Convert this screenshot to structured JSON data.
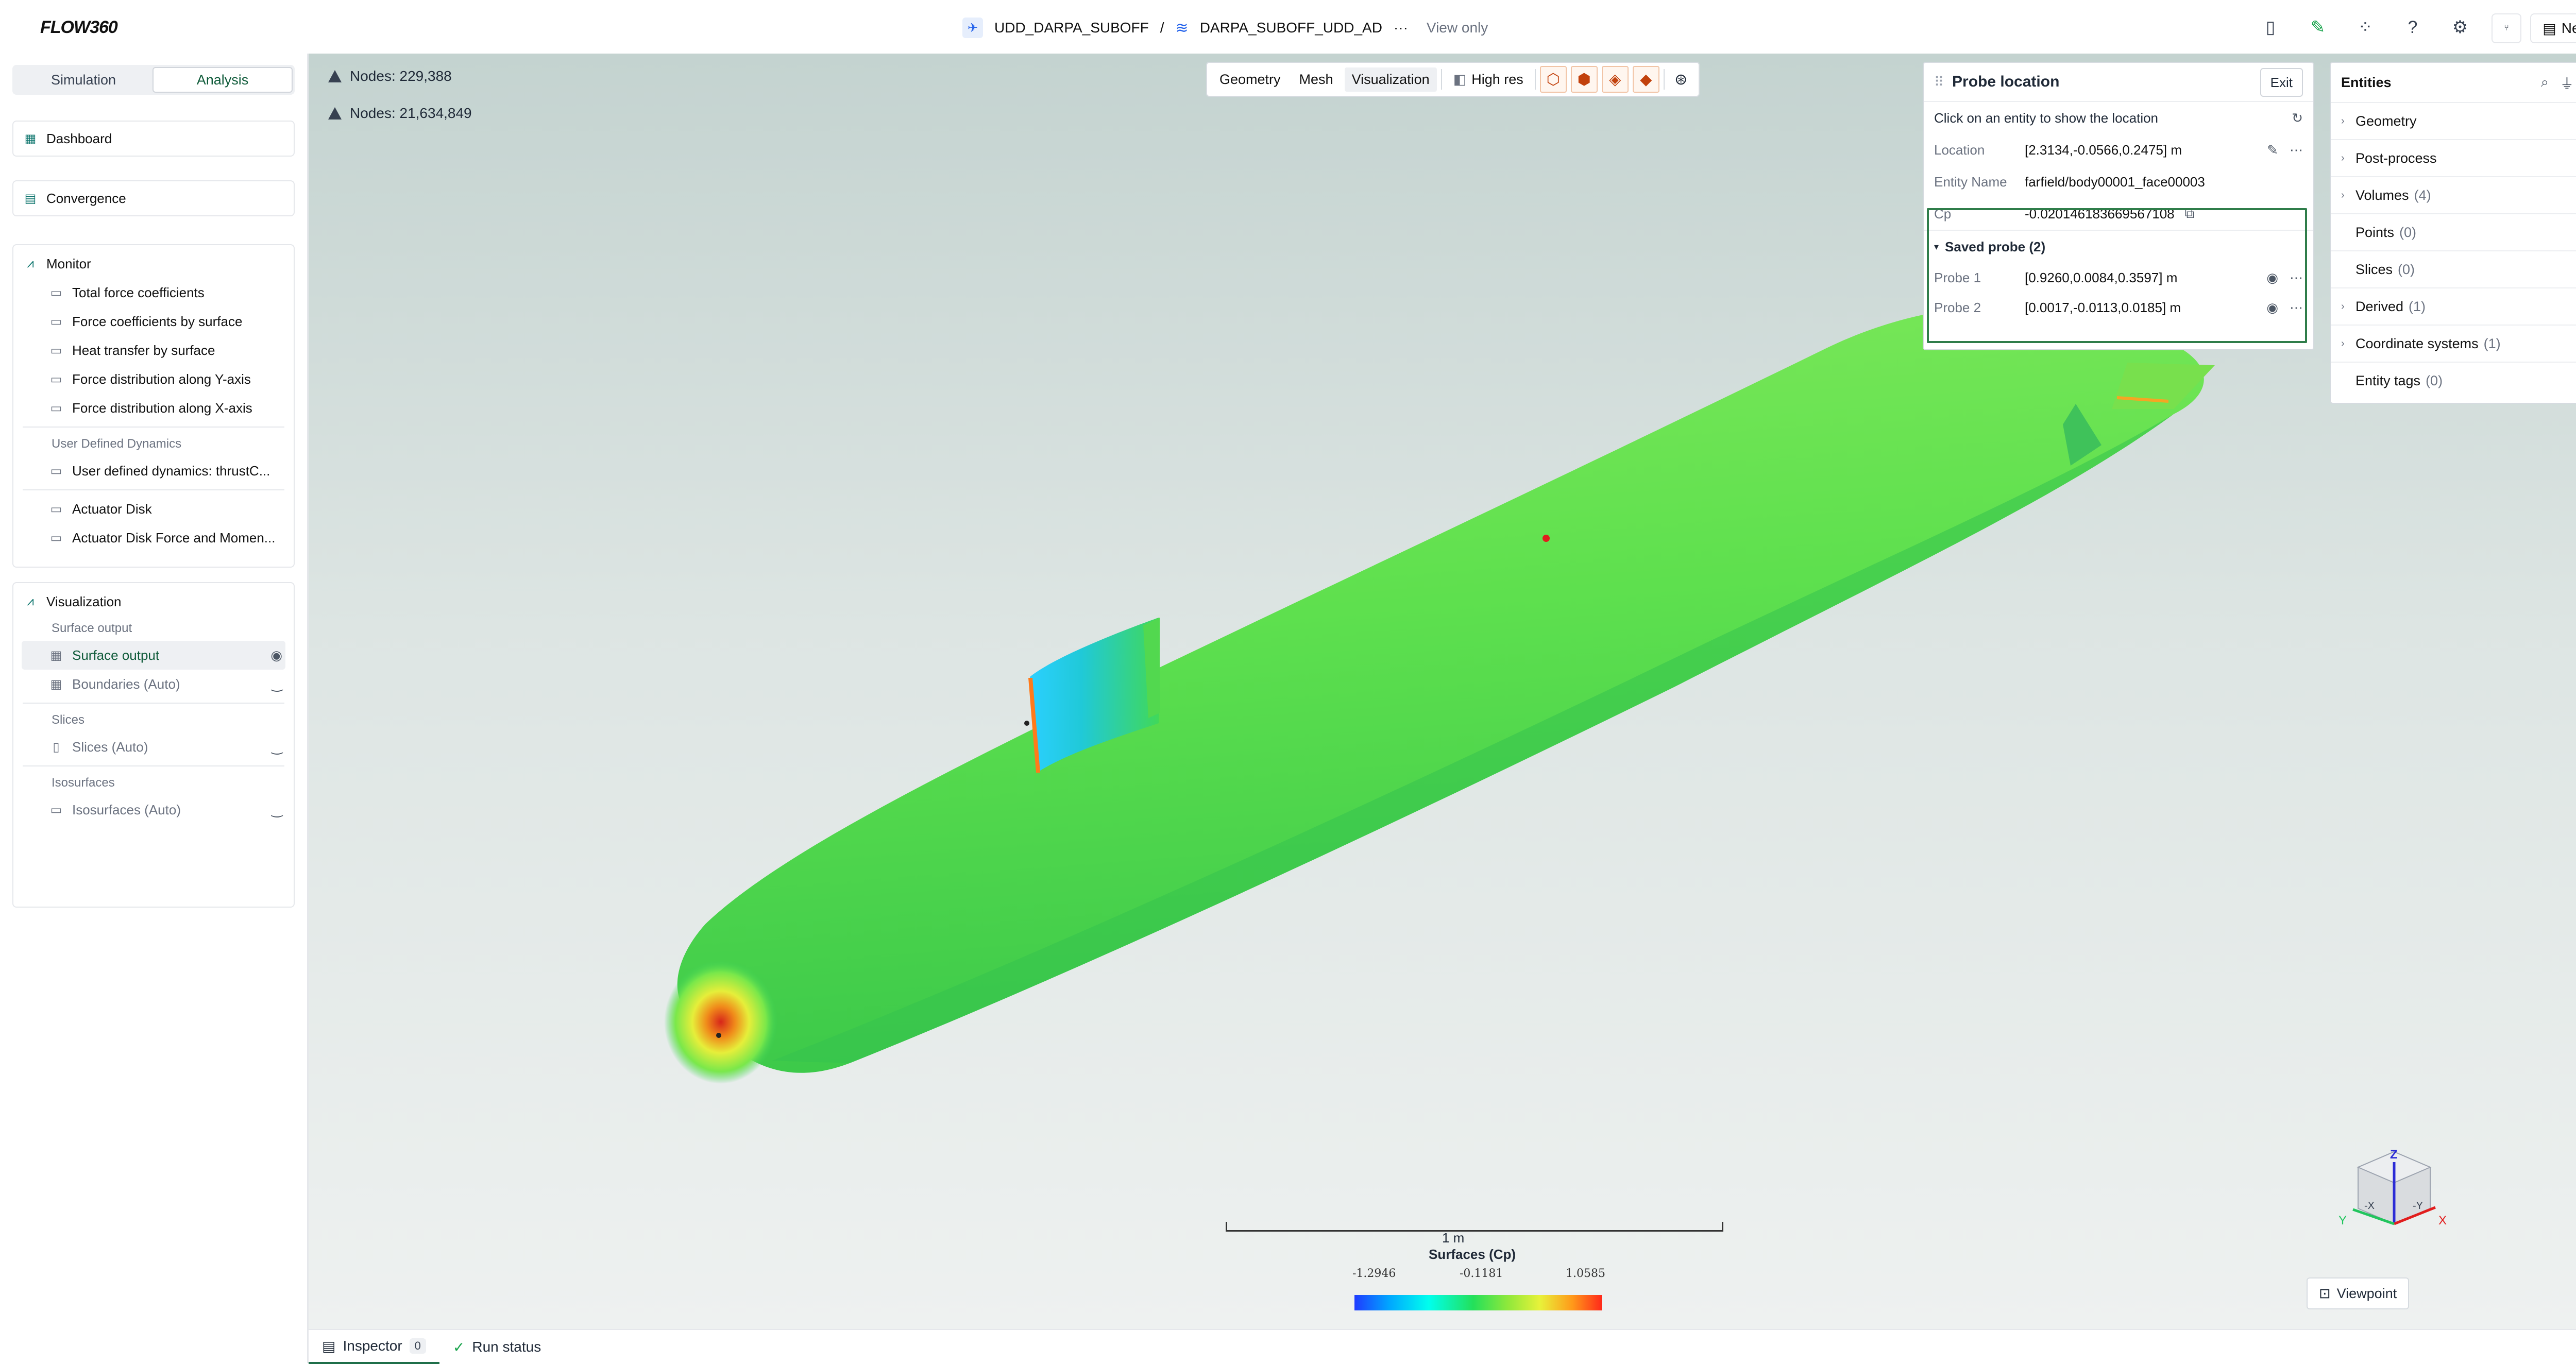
{
  "app": {
    "logo": "FLOW360"
  },
  "breadcrumb": {
    "project": "UDD_DARPA_SUBOFF",
    "separator": "/",
    "case": "DARPA_SUBOFF_UDD_AD",
    "more": "···",
    "mode": "View only"
  },
  "topbar": {
    "new_run": "New run"
  },
  "left": {
    "tabs": [
      "Simulation",
      "Analysis"
    ],
    "dashboard": "Dashboard",
    "convergence": "Convergence",
    "monitor": {
      "title": "Monitor",
      "items": [
        "Total force coefficients",
        "Force coefficients by surface",
        "Heat transfer by surface",
        "Force distribution along Y-axis",
        "Force distribution along X-axis"
      ],
      "udd_group": "User Defined Dynamics",
      "udd_item": "User defined dynamics: thrustC...",
      "actuator": [
        "Actuator Disk",
        "Actuator Disk Force and Momen..."
      ]
    },
    "visualization": {
      "title": "Visualization",
      "surface_group": "Surface output",
      "surface_item": "Surface output",
      "boundaries": "Boundaries (Auto)",
      "slices_group": "Slices",
      "slices_item": "Slices (Auto)",
      "iso_group": "Isosurfaces",
      "iso_item": "Isosurfaces (Auto)"
    }
  },
  "viewport": {
    "nodes1": "Nodes: 229,388",
    "nodes2": "Nodes: 21,634,849",
    "toolbar": {
      "geometry": "Geometry",
      "mesh": "Mesh",
      "visualization": "Visualization",
      "highres": "High res"
    },
    "scale_label": "1 m",
    "colorbar": {
      "title": "Surfaces (Cp)",
      "min": "-1.2946",
      "mid": "-0.1181",
      "max": "1.0585"
    },
    "axes": {
      "x": "X",
      "y": "Y",
      "z": "Z",
      "nx": "-X",
      "ny": "-Y"
    },
    "viewpoint": "Viewpoint"
  },
  "probe": {
    "title": "Probe location",
    "exit": "Exit",
    "hint": "Click on an entity to show the location",
    "location_label": "Location",
    "location_value": "[2.3134,-0.0566,0.2475] m",
    "entity_label": "Entity Name",
    "entity_value": "farfield/body00001_face00003",
    "cp_label": "Cp",
    "cp_value": "-0.020146183669567108",
    "saved_title": "Saved probe (2)",
    "saved": [
      {
        "label": "Probe 1",
        "value": "[0.9260,0.0084,0.3597] m"
      },
      {
        "label": "Probe 2",
        "value": "[0.0017,-0.0113,0.0185] m"
      }
    ]
  },
  "entities": {
    "title": "Entities",
    "rows": [
      {
        "label": "Geometry",
        "count": ""
      },
      {
        "label": "Post-process",
        "count": ""
      },
      {
        "label": "Volumes",
        "count": "(4)"
      },
      {
        "label": "Points",
        "count": "(0)"
      },
      {
        "label": "Slices",
        "count": "(0)"
      },
      {
        "label": "Derived",
        "count": "(1)"
      },
      {
        "label": "Coordinate systems",
        "count": "(1)"
      },
      {
        "label": "Entity tags",
        "count": "(0)"
      }
    ]
  },
  "bottom": {
    "inspector": "Inspector",
    "inspector_count": "0",
    "run_status": "Run status"
  },
  "colors": {
    "accent": "#1f6f4a",
    "probe_highlight": "#2f7d4a",
    "model_green": "#5fe05a"
  }
}
